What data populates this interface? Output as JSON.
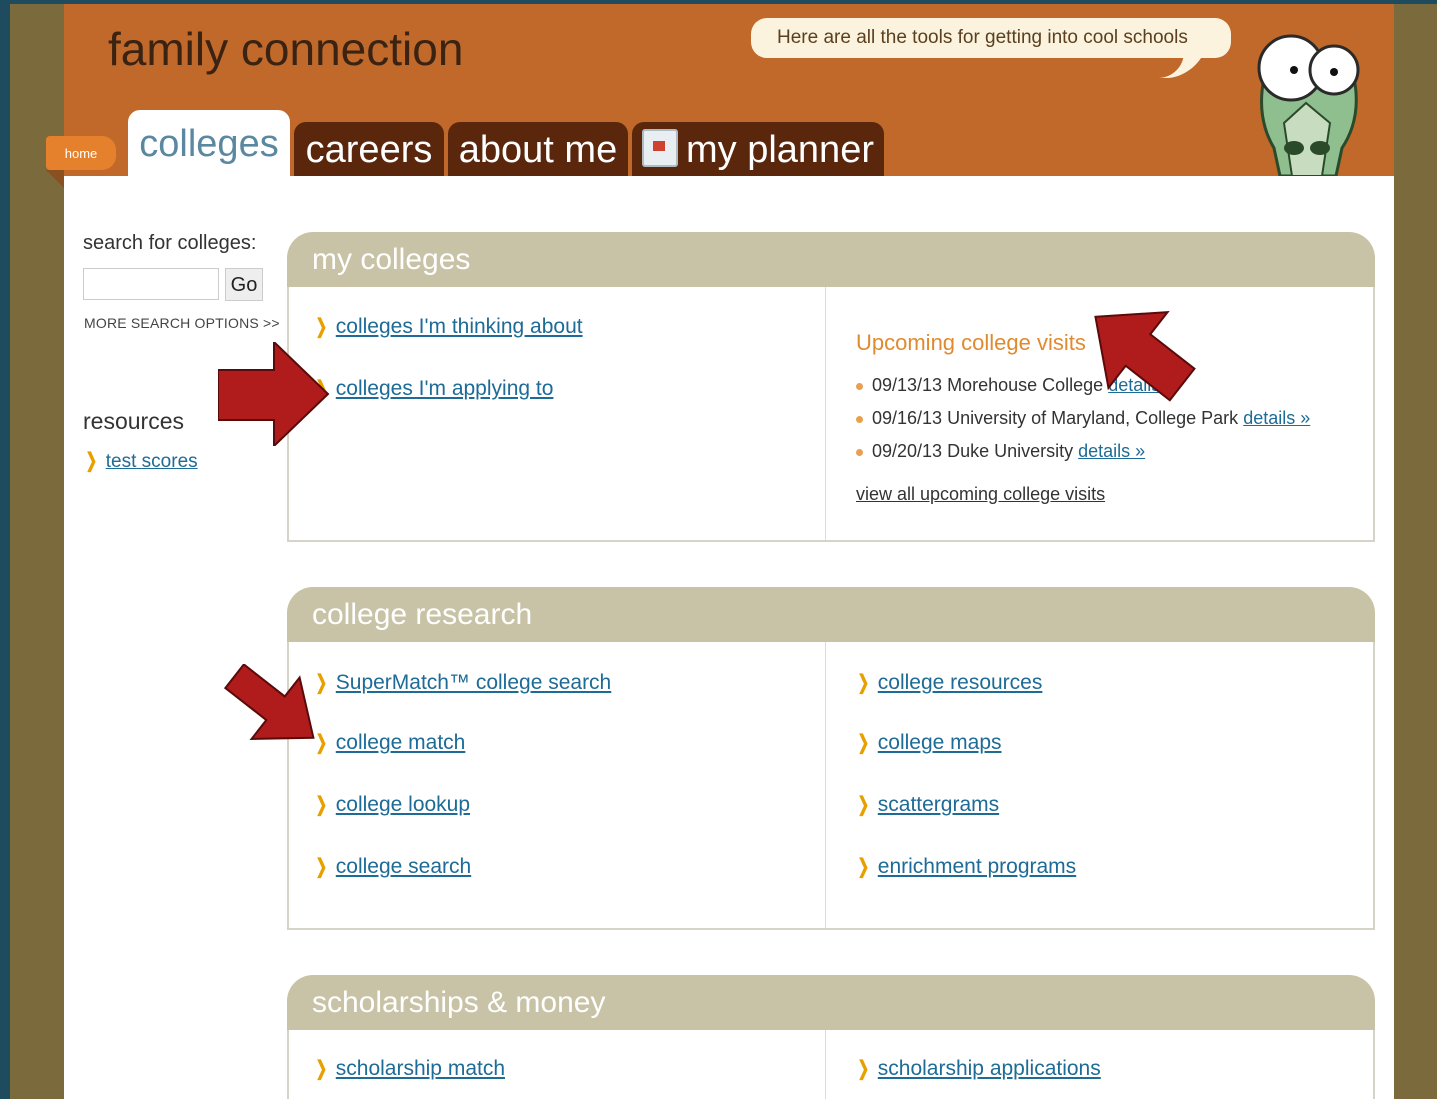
{
  "header": {
    "brand": "family connection",
    "bubble_text": "Here are all the tools for getting into cool schools",
    "home_tab": "home",
    "tabs": [
      {
        "label": "colleges",
        "active": true
      },
      {
        "label": "careers"
      },
      {
        "label": "about me"
      },
      {
        "label": "my planner"
      }
    ]
  },
  "sidebar": {
    "search_label": "search for colleges:",
    "search_value": "",
    "go_label": "Go",
    "more_options": "MORE SEARCH OPTIONS >>",
    "resources_label": "resources",
    "resources_items": [
      "test scores"
    ]
  },
  "my_colleges": {
    "title": "my colleges",
    "links": [
      "colleges I'm thinking about",
      "colleges I'm applying to"
    ],
    "visits_title": "Upcoming college visits",
    "visits": [
      {
        "text": "09/13/13 Morehouse College",
        "link": "details »"
      },
      {
        "text": "09/16/13 University of Maryland, College Park",
        "link": "details »"
      },
      {
        "text": "09/20/13 Duke University",
        "link": "details »"
      }
    ],
    "view_all": "view all upcoming college visits"
  },
  "college_research": {
    "title": "college research",
    "left_links": [
      "SuperMatch™ college search",
      "college match",
      "college lookup",
      "college search"
    ],
    "right_links": [
      "college resources",
      "college maps",
      "scattergrams",
      "enrichment programs"
    ]
  },
  "scholarships": {
    "title": "scholarships & money",
    "left_links": [
      "scholarship match"
    ],
    "right_links": [
      "scholarship applications"
    ]
  },
  "colors": {
    "header": "#c0692a",
    "tab_dark": "#5a260c",
    "panel_head": "#c8c3a6",
    "link": "#1d6b96",
    "annotation_arrow": "#b01c1c"
  }
}
